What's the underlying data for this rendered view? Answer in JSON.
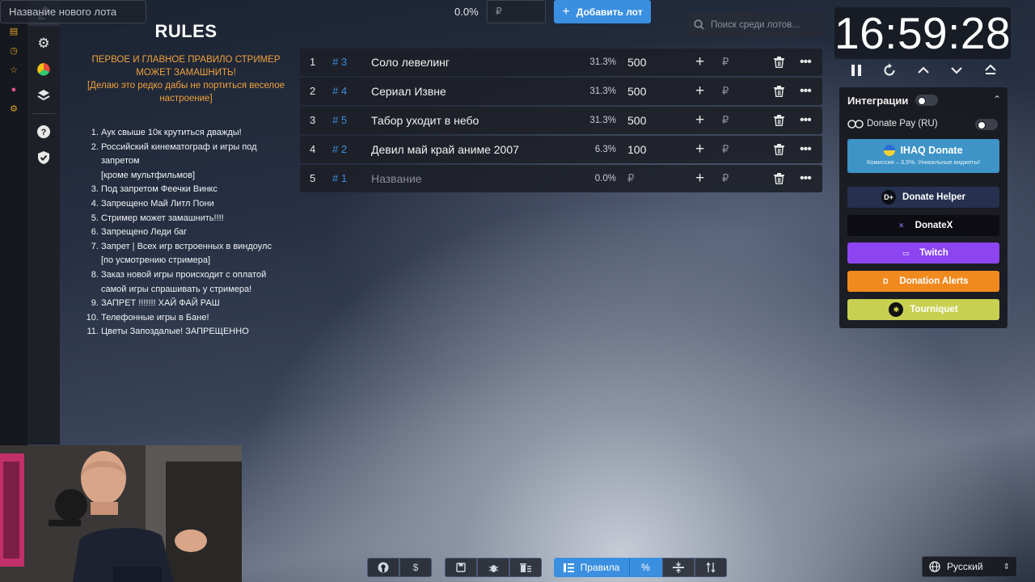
{
  "rules": {
    "title": "RULES",
    "warning_line1": "ПЕРВОЕ И ГЛАВНОЕ ПРАВИЛО СТРИМЕР МОЖЕТ ЗАМАШНИТЬ!",
    "warning_line2": "[Делаю это редко дабы не портиться веселое настроение]",
    "items": [
      {
        "text": "Аук свыше 10к крутиться дважды!"
      },
      {
        "text": "Российский кинематограф и игры  под запретом",
        "sub": "[кроме мультфильмов]"
      },
      {
        "text": "Под запретом Феечки Винкс"
      },
      {
        "text": "Запрещено Май Литл Пони"
      },
      {
        "text": "Стример может замашнить!!!!"
      },
      {
        "text": "Запрещено Леди баг"
      },
      {
        "text": "Запрет | Всех игр встроенных в виндоулс",
        "sub": "[по усмотрению стримера]"
      },
      {
        "text": "Заказ новой игры происходит с оплатой самой игры спрашивать у стримера!"
      },
      {
        "text": "ЗАПРЕТ !!!!!!! ХАЙ ФАЙ РАШ"
      },
      {
        "text": "Телефонные игры в Бане!"
      },
      {
        "text": "Цветы Запоздалые! ЗАПРЕЩЕННО"
      }
    ]
  },
  "new_lot": {
    "name_placeholder": "Название нового лота",
    "percent": "0.0%",
    "currency": "₽",
    "add_label": "Добавить лот"
  },
  "search": {
    "placeholder": "Поиск среди лотов..."
  },
  "lots": [
    {
      "index": "1",
      "id": "# 3",
      "name": "Соло левелинг",
      "percent": "31.3%",
      "amount": "500",
      "currency": "₽"
    },
    {
      "index": "2",
      "id": "# 4",
      "name": "Сериал Извне",
      "percent": "31.3%",
      "amount": "500",
      "currency": "₽"
    },
    {
      "index": "3",
      "id": "# 5",
      "name": "Табор уходит в небо",
      "percent": "31.3%",
      "amount": "500",
      "currency": "₽"
    },
    {
      "index": "4",
      "id": "# 2",
      "name": "Девил май край аниме 2007",
      "percent": "6.3%",
      "amount": "100",
      "currency": "₽"
    },
    {
      "index": "5",
      "id": "# 1",
      "name": "Название",
      "percent": "0.0%",
      "amount": "₽",
      "currency": "₽"
    }
  ],
  "timer": {
    "time": "16:59:28"
  },
  "integrations": {
    "title": "Интеграции",
    "donate_pay": "Donate Pay (RU)",
    "iqhaq_title": "IHAQ Donate",
    "iqhaq_sub": "Комиссия – 3,5%. Уникальные виджеты!",
    "services": [
      {
        "label": "Donate Helper",
        "color": "#26304f",
        "logo": "D+",
        "logo_bg": "#0d0f14",
        "logo_fg": "#fff"
      },
      {
        "label": "DonateX",
        "color": "#0c0c12",
        "logo": "✕",
        "logo_bg": "transparent",
        "logo_fg": "#8d7cf0"
      },
      {
        "label": "Twitch",
        "color": "#8c45f0",
        "logo": "▭",
        "logo_bg": "transparent",
        "logo_fg": "#fff"
      },
      {
        "label": "Donation Alerts",
        "color": "#f08a1f",
        "logo": "D",
        "logo_bg": "transparent",
        "logo_fg": "#fff"
      },
      {
        "label": "Tourniquet",
        "color": "#c8d052",
        "logo": "✱",
        "logo_bg": "#111",
        "logo_fg": "#d8e04a"
      }
    ]
  },
  "toolbar": {
    "rules_label": "Правила",
    "percent_label": "%",
    "github_icon": "github-icon",
    "dollar_label": "$"
  },
  "language": {
    "selected": "Русский"
  },
  "colors": {
    "accent": "#3a8fe0",
    "id_blue": "#3e8be0",
    "warning_orange": "#f0a13c"
  }
}
